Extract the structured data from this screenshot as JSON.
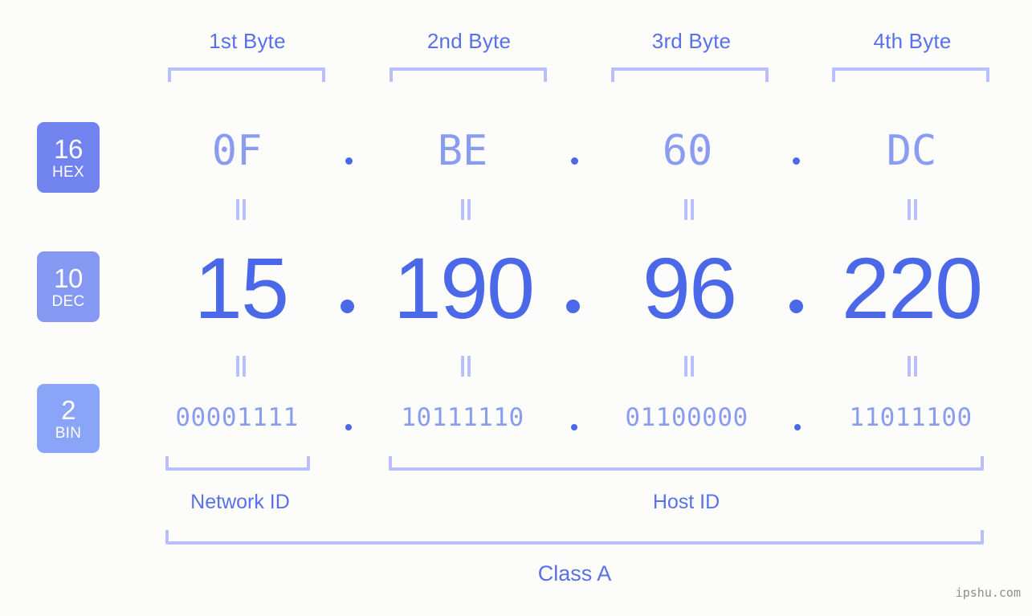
{
  "background_color": "#fcfdfa",
  "accent_color": "#4a68e8",
  "accent_light": "#8a9cf0",
  "bracket_color": "#b7c0fb",
  "header": {
    "bytes": [
      {
        "label": "1st Byte"
      },
      {
        "label": "2nd Byte"
      },
      {
        "label": "3rd Byte"
      },
      {
        "label": "4th Byte"
      }
    ]
  },
  "bases": [
    {
      "num": "16",
      "name": "HEX",
      "color": "#7183ee"
    },
    {
      "num": "10",
      "name": "DEC",
      "color": "#8598f2"
    },
    {
      "num": "2",
      "name": "BIN",
      "color": "#8aa5f8"
    }
  ],
  "rows": {
    "hex": {
      "octets": [
        "0F",
        "BE",
        "60",
        "DC"
      ],
      "separator": "."
    },
    "dec": {
      "octets": [
        "15",
        "190",
        "96",
        "220"
      ],
      "separator": "."
    },
    "bin": {
      "octets": [
        "00001111",
        "10111110",
        "01100000",
        "11011100"
      ],
      "separator": "."
    }
  },
  "equals_symbol": "=",
  "sections": {
    "network_id": "Network ID",
    "host_id": "Host ID",
    "class": "Class A"
  },
  "watermark": "ipshu.com"
}
